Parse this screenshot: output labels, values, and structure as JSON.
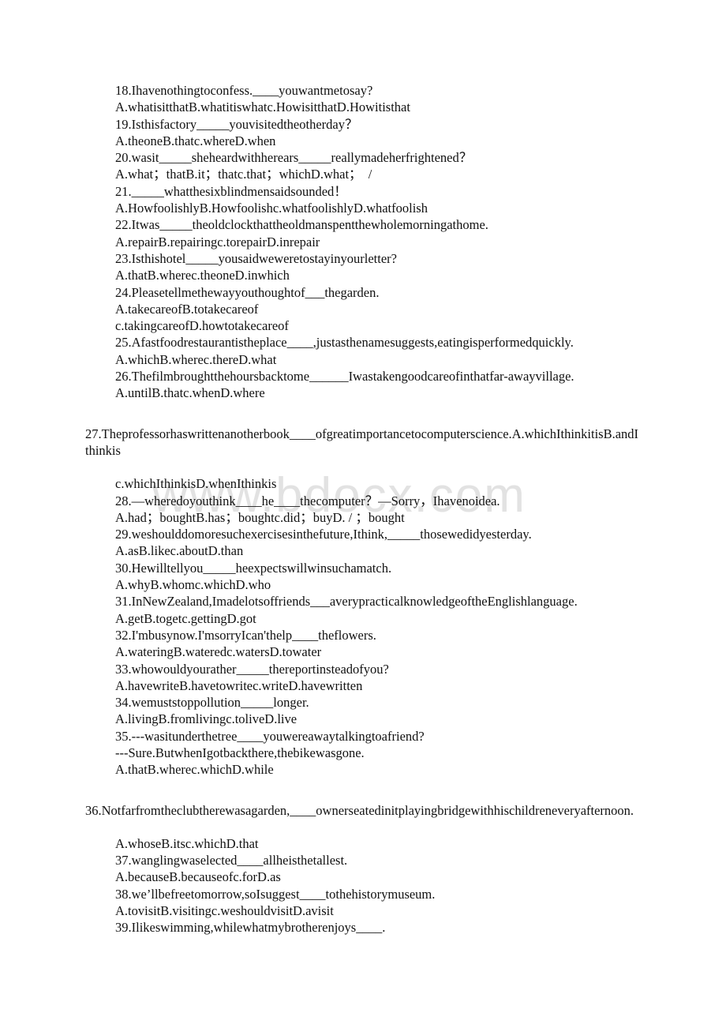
{
  "document": {
    "type": "scanned-worksheet",
    "background_color": "#ffffff",
    "text_color": "#111111"
  },
  "watermark": {
    "text": "www.bdocx.com",
    "color": "#e2e2e2"
  },
  "blocks": [
    {
      "id": "block-1",
      "indent": "inner",
      "lines": [
        "18.Ihavenothingtoconfess.____youwantmetosay?",
        "A.whatisitthatB.whatitiswhatc.HowisitthatD.Howitisthat",
        "19.Isthisfactory_____youvisitedtheotherday？",
        "A.theoneB.thatc.whereD.when",
        "20.wasit_____sheheardwithherears_____reallymadeherfrightened？",
        "A.what；thatB.it；thatc.that；whichD.what；  /",
        "21._____whatthesixblindmensaidsounded！",
        "A.HowfoolishlyB.Howfoolishc.whatfoolishlyD.whatfoolish",
        "22.Itwas_____theoldclockthattheoldmanspentthewholemorningathome.",
        "A.repairB.repairingc.torepairD.inrepair",
        "23.Isthishotel_____yousaidweweretostayinyourletter?",
        "A.thatB.wherec.theoneD.inwhich",
        "24.Pleasetellmethewayyouthoughtof___thegarden.",
        "A.takecareofB.totakecareof",
        "c.takingcareofD.howtotakecareof",
        "25.Afastfoodrestaurantistheplace____,justasthenamesuggests,eatingisperformedquickly.",
        "A.whichB.wherec.thereD.what",
        "26.Thefilmbroughtthehoursbacktome______Iwastakengoodcareofinthatfar-awayvillage.",
        "A.untilB.thatc.whenD.where"
      ]
    },
    {
      "id": "block-2",
      "indent": "outer",
      "lines": [
        "27.Theprofessorhaswrittenanotherbook____ofgreatimportancetocomputerscience.A.whichIthinkitisB.andIthinkis"
      ]
    },
    {
      "id": "block-3",
      "indent": "inner",
      "lines": [
        "c.whichIthinkisD.whenIthinkis",
        "28.—wheredoyouthink____he____thecomputer？—Sorry，Ihavenoidea.",
        "A.had；boughtB.has；boughtc.did；buyD. / ；bought",
        "29.weshoulddomoresuchexercisesinthefuture,Ithink,_____thosewedidyesterday.",
        "A.asB.likec.aboutD.than",
        "30.Hewilltellyou_____heexpectswillwinsuchamatch.",
        "A.whyB.whomc.whichD.who",
        "31.InNewZealand,Imadelotsoffriends___averypracticalknowledgeoftheEnglishlanguage.",
        "A.getB.togetc.gettingD.got",
        "32.I'mbusynow.I'msorryIcan'thelp____theflowers.",
        "A.wateringB.wateredc.watersD.towater",
        "33.whowouldyourather_____thereportinsteadofyou?",
        "A.havewriteB.havetowritec.writeD.havewritten",
        "34.wemuststoppollution_____longer.",
        "A.livingB.fromlivingc.toliveD.live",
        "35.---wasitunderthetree____youwereawaytalkingtoafriend?",
        "---Sure.ButwhenIgotbackthere,thebikewasgone.",
        "A.thatB.wherec.whichD.while"
      ]
    },
    {
      "id": "block-4",
      "indent": "outer",
      "lines": [
        "36.Notfarfromtheclubtherewasagarden,____ownerseatedinitplayingbridgewithhischildreneveryafternoon."
      ]
    },
    {
      "id": "block-5",
      "indent": "inner",
      "lines": [
        "A.whoseB.itsc.whichD.that",
        "37.wanglingwaselected____allheisthetallest.",
        "A.becauseB.becauseofc.forD.as",
        "38.we’llbefreetomorrow,soIsuggest____tothehistorymuseum.",
        "A.tovisitB.visitingc.weshouldvisitD.avisit",
        "39.Ilikeswimming,whilewhatmybrotherenjoys____."
      ]
    }
  ]
}
